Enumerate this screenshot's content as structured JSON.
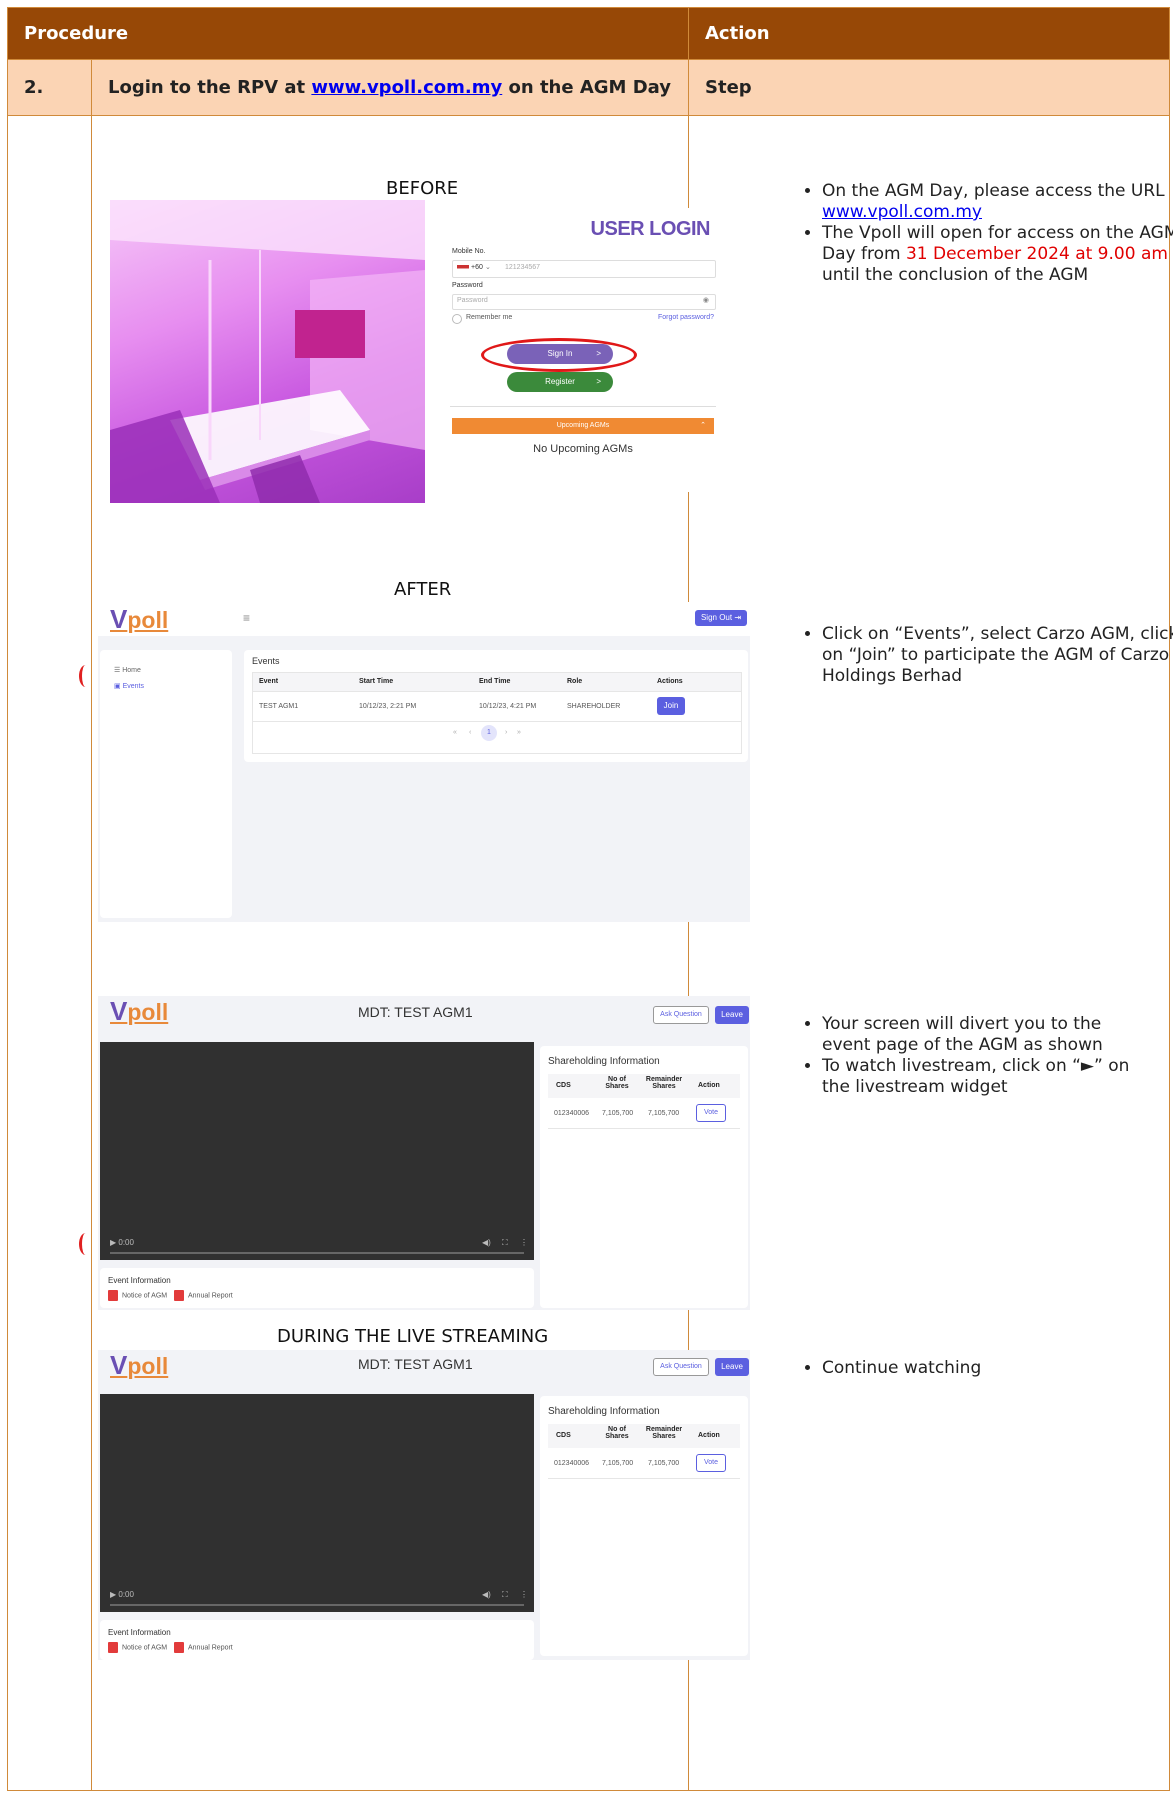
{
  "table": {
    "header": {
      "procedure": "Procedure",
      "action": "Action"
    },
    "step_row": {
      "number": "2.",
      "title_pre": "Login to the RPV at ",
      "title_link": "www.vpoll.com.my",
      "title_post": " on the AGM Day",
      "action": "Step"
    }
  },
  "captions": {
    "before": "BEFORE",
    "after": "AFTER",
    "live": "DURING THE LIVE STREAMING"
  },
  "actions": {
    "block1": {
      "b1_pre": "On the AGM Day, please access the URL ",
      "b1_link": "www.vpoll.com.my",
      "b2_pre": "The Vpoll will open for access on the AGM Day from ",
      "b2_red": "31 December 2024 at 9.00 am",
      "b2_post": " until the conclusion of the AGM"
    },
    "block2": "Click on “Events”, select Carzo AGM, click on “Join” to participate the AGM of Carzo Holdings Berhad",
    "block3": {
      "b1": "Your screen will divert you to the event page of the AGM as shown",
      "b2": "To watch livestream, click on “►” on the livestream widget"
    },
    "block4": "Continue watching"
  },
  "login": {
    "title": "USER LOGIN",
    "mobile_label": "Mobile No.",
    "country_code": "+60",
    "mobile_placeholder": "121234567",
    "password_label": "Password",
    "password_placeholder": "Password",
    "remember": "Remember me",
    "forgot": "Forgot password?",
    "sign_in": "Sign In",
    "register": "Register",
    "upcoming": "Upcoming AGMs",
    "no_upcoming": "No Upcoming AGMs"
  },
  "events_app": {
    "logo_v": "V",
    "logo_rest": "poll",
    "sign_out": "Sign Out",
    "nav": [
      "Home",
      "Events"
    ],
    "panel_title": "Events",
    "columns": [
      "Event",
      "Start Time",
      "End Time",
      "Role",
      "Actions"
    ],
    "row": [
      "TEST AGM1",
      "10/12/23, 2:21 PM",
      "10/12/23, 4:21 PM",
      "SHAREHOLDER"
    ],
    "join": "Join",
    "page": "1"
  },
  "event_page": {
    "title": "MDT: TEST AGM1",
    "ask": "Ask Question",
    "leave": "Leave",
    "time": "0:00",
    "share_title": "Shareholding Information",
    "columns": [
      "CDS",
      "No of Shares",
      "Remainder Shares",
      "Action"
    ],
    "row": [
      "012340006",
      "7,105,700",
      "7,105,700"
    ],
    "vote": "Vote",
    "event_info": "Event Information",
    "notice": "Notice of AGM",
    "report": "Annual Report"
  }
}
